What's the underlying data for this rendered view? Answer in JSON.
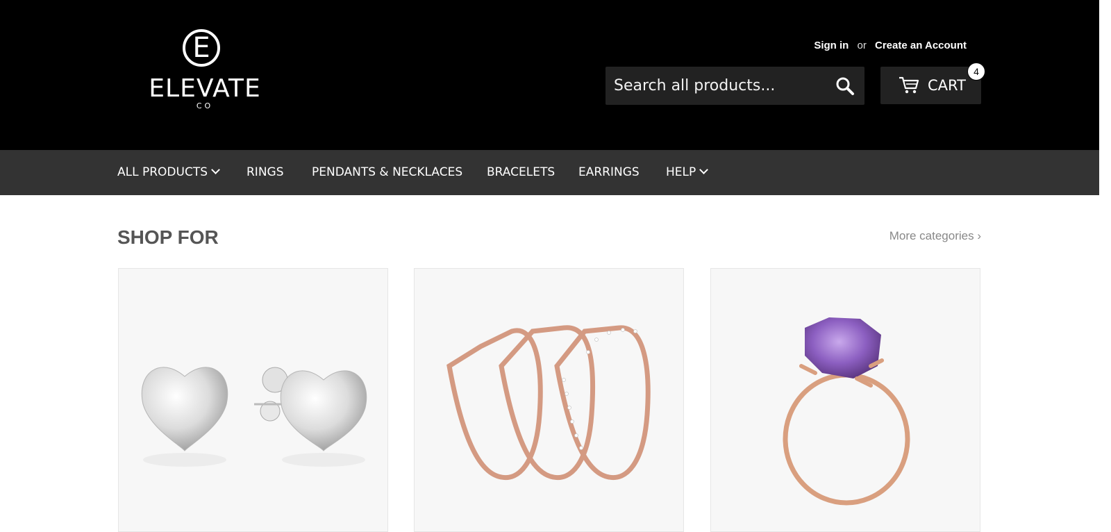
{
  "header": {
    "logo": {
      "letter": "E",
      "name": "ELEVATE",
      "sub": "CO"
    },
    "account": {
      "sign_in": "Sign in",
      "or": "or",
      "create": "Create an Account"
    },
    "search": {
      "placeholder": "Search all products...",
      "icon": "search-icon"
    },
    "cart": {
      "label": "CART",
      "count": "4",
      "icon": "cart-icon"
    }
  },
  "nav": {
    "items": [
      {
        "label": "ALL PRODUCTS",
        "dropdown": true
      },
      {
        "label": "RINGS",
        "dropdown": false
      },
      {
        "label": "PENDANTS & NECKLACES",
        "dropdown": false
      },
      {
        "label": "BRACELETS",
        "dropdown": false
      },
      {
        "label": "EARRINGS",
        "dropdown": false
      },
      {
        "label": "HELP",
        "dropdown": true
      }
    ]
  },
  "main": {
    "section_title": "SHOP FOR",
    "more_link": "More categories ›",
    "cards": [
      {
        "image": "silver-heart-earrings"
      },
      {
        "image": "rose-gold-stacked-rings"
      },
      {
        "image": "amethyst-rose-gold-ring"
      }
    ]
  },
  "colors": {
    "header_bg": "#000000",
    "nav_bg": "#333333",
    "input_bg": "#222222",
    "title": "#555555"
  }
}
